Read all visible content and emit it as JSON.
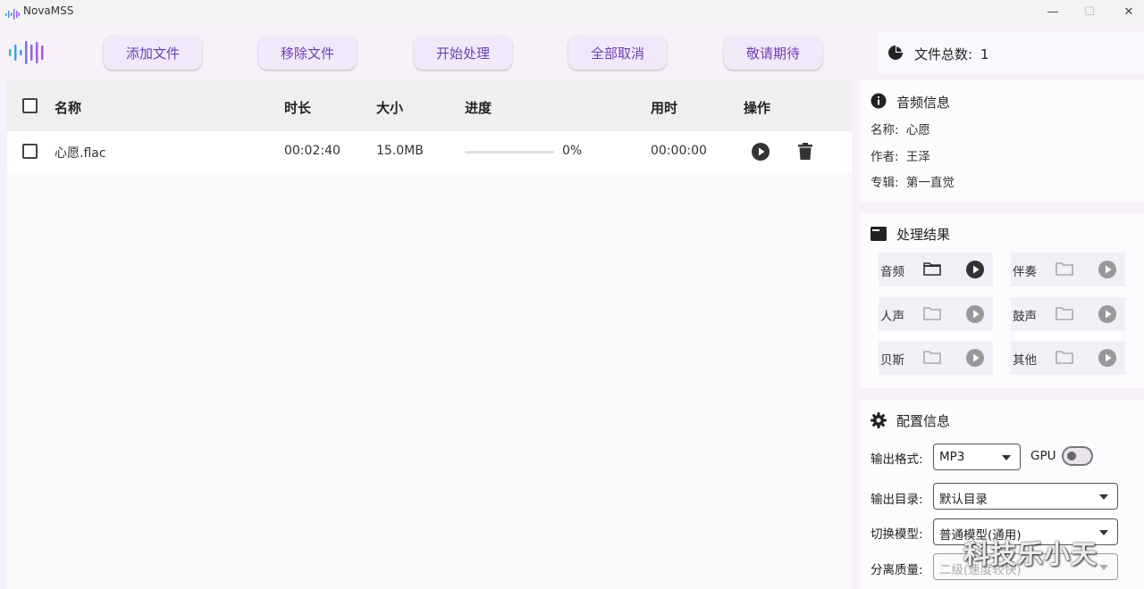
{
  "window": {
    "title": "NovaMSS",
    "minimize": "—",
    "maximize": "☐",
    "close": "✕"
  },
  "toolbar": {
    "buttons": [
      "添加文件",
      "移除文件",
      "开始处理",
      "全部取消",
      "敬请期待"
    ],
    "file_count_label": "文件总数:",
    "file_count_value": "1"
  },
  "table": {
    "headers": {
      "name": "名称",
      "duration": "时长",
      "size": "大小",
      "progress": "进度",
      "elapsed": "用时",
      "actions": "操作"
    },
    "rows": [
      {
        "name": "心愿.flac",
        "duration": "00:02:40",
        "size": "15.0MB",
        "progress": 0,
        "progress_text": "0%",
        "elapsed": "00:00:00"
      }
    ]
  },
  "audio_info": {
    "title": "音频信息",
    "name_label": "名称:",
    "name_value": "心愿",
    "artist_label": "作者:",
    "artist_value": "王泽",
    "album_label": "专辑:",
    "album_value": "第一直觉"
  },
  "results": {
    "title": "处理结果",
    "items": [
      {
        "label": "音频",
        "enabled": true
      },
      {
        "label": "伴奏",
        "enabled": false
      },
      {
        "label": "人声",
        "enabled": false
      },
      {
        "label": "鼓声",
        "enabled": false
      },
      {
        "label": "贝斯",
        "enabled": false
      },
      {
        "label": "其他",
        "enabled": false
      }
    ]
  },
  "config": {
    "title": "配置信息",
    "format_label": "输出格式:",
    "format_value": "MP3",
    "gpu_label": "GPU",
    "gpu_enabled": false,
    "output_dir_label": "输出目录:",
    "output_dir_value": "默认目录",
    "model_label": "切换模型:",
    "model_value": "普通模型(通用)",
    "quality_label": "分离质量:",
    "quality_value": "二级(速度较快)"
  },
  "watermark": "科技乐小天",
  "colors": {
    "accent": "#6a41b0",
    "button_bg": "#f1e8f9",
    "background": "#f7f2fa"
  }
}
